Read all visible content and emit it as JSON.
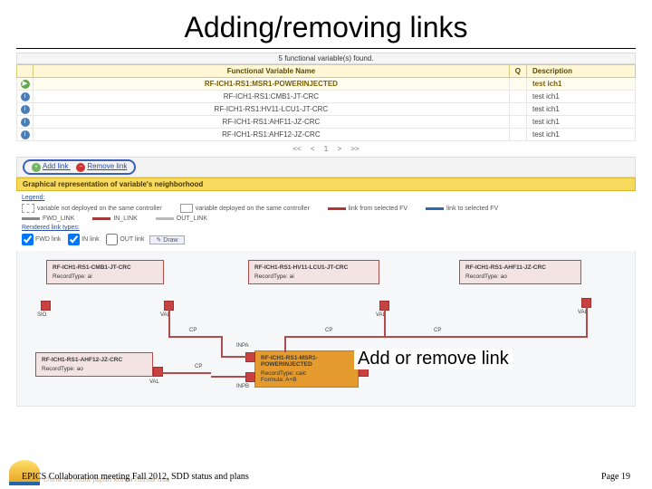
{
  "title": "Adding/removing links",
  "found_text": "5 functional variable(s) found.",
  "table": {
    "headers": {
      "name": "Functional Variable Name",
      "q": "Q",
      "desc": "Description"
    },
    "rows": [
      {
        "name": "RF-ICH1-RS1:MSR1-POWERINJECTED",
        "desc": "test ich1",
        "highlight": true,
        "icon": "play"
      },
      {
        "name": "RF-ICH1-RS1:CMB1-JT-CRC",
        "desc": "test ich1",
        "highlight": false,
        "icon": "info"
      },
      {
        "name": "RF-ICH1-RS1:HV11-LCU1-JT-CRC",
        "desc": "test ich1",
        "highlight": false,
        "icon": "info"
      },
      {
        "name": "RF-ICH1-RS1:AHF11-JZ-CRC",
        "desc": "test ich1",
        "highlight": false,
        "icon": "info"
      },
      {
        "name": "RF-ICH1-RS1:AHF12-JZ-CRC",
        "desc": "test ich1",
        "highlight": false,
        "icon": "info"
      }
    ]
  },
  "pager": {
    "first": "<<",
    "prev": "<",
    "cur": "1",
    "next": ">",
    "last": ">>"
  },
  "actions": {
    "add_icon_symbol": "+",
    "add": "Add link",
    "remove_icon_symbol": "−",
    "remove": "Remove link"
  },
  "section_head": "Graphical representation of variable's neighborhood",
  "legend": {
    "label": "Legend:",
    "items": {
      "not_deployed": "variable not deployed on the same controller",
      "deployed": "variable deployed on the same controller",
      "link_from": "link from selected FV",
      "link_to": "link to selected FV",
      "fwd": "FWD_LINK",
      "in": "IN_LINK",
      "out": "OUT_LINK"
    },
    "rendered_label": "Rendered link types:",
    "checks": {
      "fwd": "FWD link",
      "in": "IN link",
      "out": "OUT link"
    },
    "draw": "Draw"
  },
  "nodes": {
    "n1": {
      "name": "RF-ICH1-RS1-CMB1-JT-CRC",
      "type": "RecordType: ai"
    },
    "n2": {
      "name": "RF-ICH1-RS1-HV11-LCU1-JT-CRC",
      "type": "RecordType: ai"
    },
    "n3": {
      "name": "RF-ICH1-RS1-AHF11-JZ-CRC",
      "type": "RecordType: ao"
    },
    "n4": {
      "name": "RF-ICH1-RS1-AHF12-JZ-CRC",
      "type": "RecordType: ao"
    },
    "n5": {
      "name": "RF-ICH1-RS1-MSR1-POWERINJECTED",
      "type": "RecordType: calc",
      "extra": "Formula: A+B"
    }
  },
  "ports": {
    "val": "VAL",
    "cp": "CP",
    "inpa": "INPA",
    "inpb": "INPB",
    "sio": "SIO"
  },
  "annotation": "Add or remove link",
  "footer": {
    "left": "EPICS Collaboration meeting Fall 2012, SDD status and plans",
    "right": "Page 19"
  },
  "partners": "china eu india japan korea russia usa"
}
